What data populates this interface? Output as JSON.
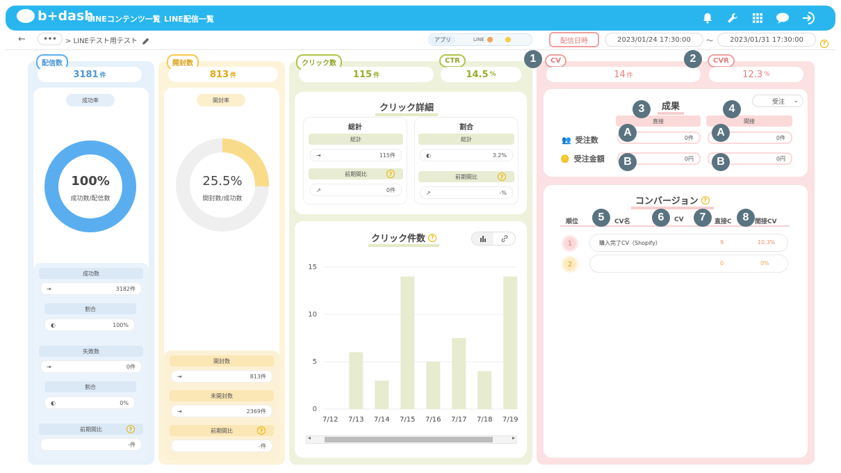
{
  "app": {
    "logo": "b+dash"
  },
  "nav": {
    "content_list": "LINEコンテンツ一覧",
    "delivery_list": "LINE配信一覧"
  },
  "breadcrumb": {
    "more": "•••",
    "title": "> LINEテスト用テスト"
  },
  "filters": {
    "app_label": "アプリ",
    "line_label": "LINE",
    "date_button": "配信日時",
    "start": "2023/01/24 17:30:00",
    "tilde": "〜",
    "end": "2023/01/31 17:30:00"
  },
  "colors": {
    "blue": "#5aaeef",
    "yellow": "#f5c94a",
    "green": "#b2c24a",
    "red": "#f29e9e"
  },
  "delivery": {
    "label": "配信数",
    "value": "3181",
    "unit": "件",
    "rate_label": "成功率",
    "donut_value": "100%",
    "donut_caption": "成功数/配信数",
    "donut_fraction": 1.0,
    "success_label": "成功数",
    "success_value": "3182件",
    "ratio_label": "割合",
    "ratio_value": "100%",
    "fail_label": "失敗数",
    "fail_value": "0件",
    "fail_ratio_label": "割合",
    "fail_ratio_value": "0%",
    "prev_label": "前期間比",
    "prev_value": "-件"
  },
  "open": {
    "label": "開封数",
    "value": "813",
    "unit": "件",
    "rate_label": "開封率",
    "donut_value": "25.5%",
    "donut_caption": "開封数/成功数",
    "donut_fraction": 0.255,
    "opened_label": "開封数",
    "opened_value": "813件",
    "unopened_label": "未開封数",
    "unopened_value": "2369件",
    "prev_label": "前期間比",
    "prev_value": "-件"
  },
  "click": {
    "label": "クリック数",
    "value": "115",
    "unit": "件",
    "ctr_label": "CTR",
    "ctr_value": "14.5",
    "ctr_unit": "%",
    "detail_title": "クリック詳細",
    "total_head": "総計",
    "total_sub": "総計",
    "total_value": "115件",
    "prev_sub": "前期間比",
    "prev_value": "0件",
    "ratio_head": "割合",
    "ratio_sub": "総計",
    "ratio_value": "3.2%",
    "ratio_prev_sub": "前期間比",
    "ratio_prev_value": "-%",
    "chart_title": "クリック件数"
  },
  "chart_data": {
    "type": "bar",
    "categories": [
      "7/12",
      "7/13",
      "7/14",
      "7/15",
      "7/16",
      "7/17",
      "7/18",
      "7/19"
    ],
    "values": [
      0,
      6,
      3,
      14,
      5,
      7.5,
      4,
      14
    ],
    "ylim": [
      0,
      15
    ],
    "yticks": [
      "0",
      "5",
      "10",
      "15"
    ],
    "grid": true
  },
  "cv": {
    "cv_label": "CV",
    "cv_value": "14",
    "cv_unit": "件",
    "cvr_label": "CVR",
    "cvr_value": "12.3",
    "cvr_unit": "%",
    "result_title": "成果",
    "select_value": "受注",
    "direct_label": "直接",
    "indirect_label": "間接",
    "orders_label": "受注数",
    "amount_label": "受注金額",
    "direct_orders": "0件",
    "indirect_orders": "0件",
    "direct_amount": "0円",
    "indirect_amount": "0円",
    "conv_title": "コンバージョン",
    "head_rank": "順位",
    "head_name": "CV名",
    "head_cv": "CV",
    "head_direct": "直接C",
    "head_indirect": "間接CV",
    "rows": [
      {
        "rank": "1",
        "name": "購入完了CV（Shopify）",
        "count": "9",
        "rate": "10.3%"
      },
      {
        "rank": "2",
        "name": "",
        "count": "0",
        "rate": "0%"
      }
    ]
  },
  "markers": [
    "1",
    "2",
    "3",
    "4",
    "5",
    "6",
    "7",
    "8"
  ],
  "marker_letters": [
    "A",
    "B",
    "A",
    "B"
  ],
  "icons": [
    "bell-icon",
    "wrench-icon",
    "grid-icon",
    "chat-icon",
    "logout-icon",
    "back-icon",
    "pencil-icon",
    "help-icon"
  ]
}
